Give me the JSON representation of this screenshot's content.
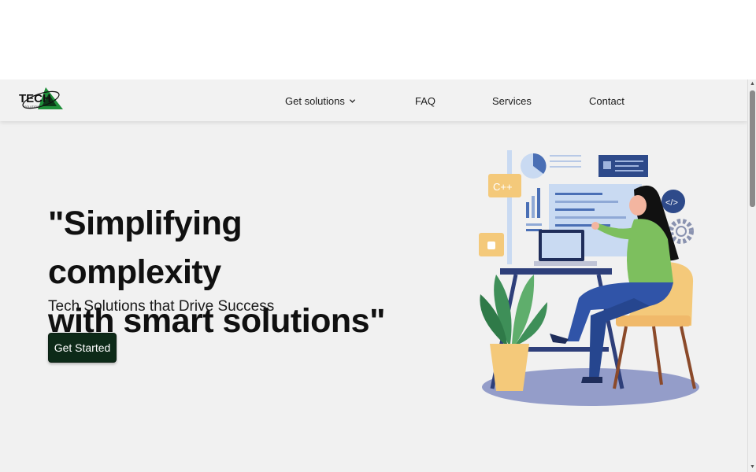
{
  "logo": {
    "text": "TECH",
    "subtext": "SOLUTIONS"
  },
  "nav": {
    "get_solutions": "Get solutions",
    "faq": "FAQ",
    "services": "Services",
    "contact": "Contact"
  },
  "hero": {
    "headline_line1": "\"Simplifying complexity",
    "headline_line2": "with smart solutions\"",
    "subheadline": "Tech Solutions that Drive Success",
    "cta_label": "Get Started"
  },
  "illustration": {
    "code_badge": "C++",
    "code_bubble": "</>"
  },
  "colors": {
    "cta_bg": "#0d2a18",
    "hero_bg": "#f1f1f1",
    "accent_blue": "#4a6fb5",
    "accent_green": "#7dbf5e",
    "accent_orange": "#f4c97a"
  }
}
